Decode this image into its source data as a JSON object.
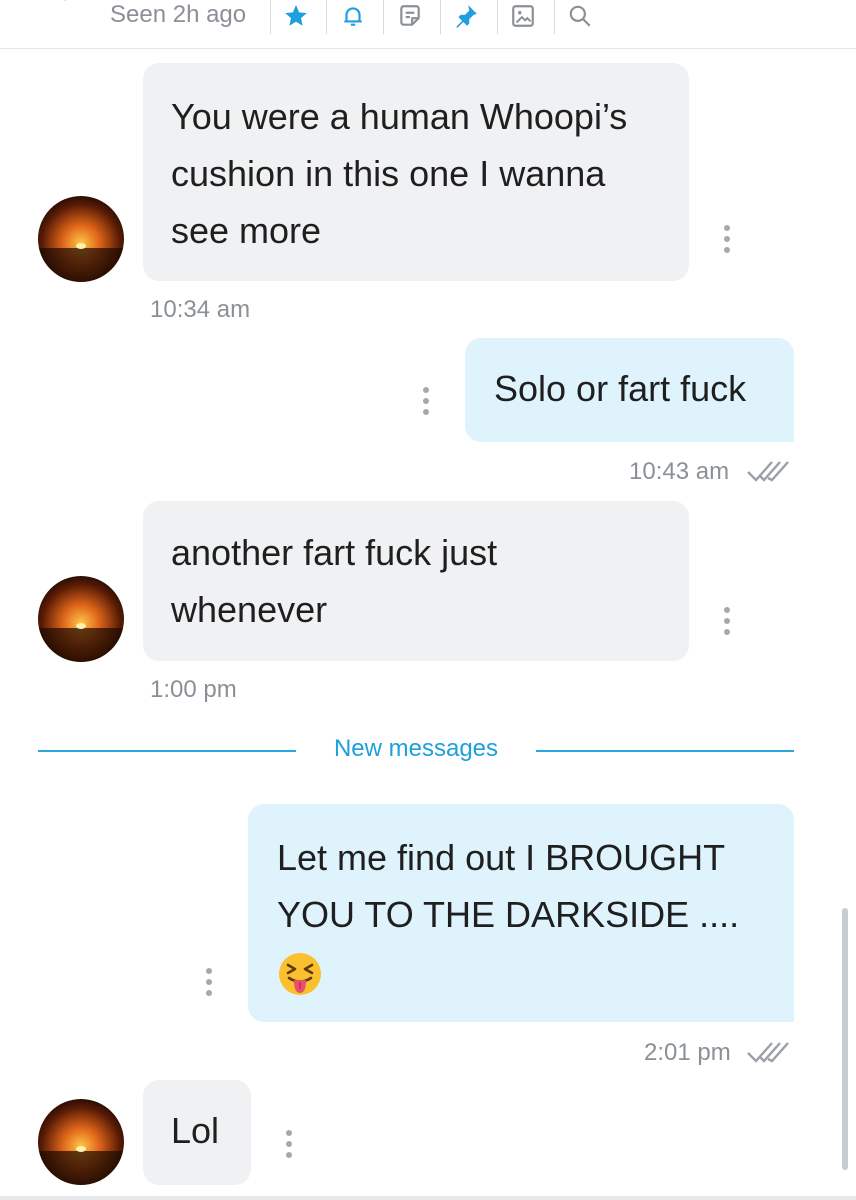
{
  "header": {
    "seen_text": "Seen 2h ago",
    "icons": [
      "star-icon",
      "bell-icon",
      "note-icon",
      "pin-icon",
      "image-icon",
      "search-icon"
    ]
  },
  "messages": [
    {
      "direction": "incoming",
      "text": "You were a human Whoopi’s\ncushion in this one I wanna\nsee more",
      "time": "10:34 am"
    },
    {
      "direction": "outgoing",
      "text": "Solo or fart fuck",
      "time": "10:43 am",
      "status": "read"
    },
    {
      "direction": "incoming",
      "text": "another fart fuck just\nwhenever",
      "time": "1:00 pm"
    },
    {
      "direction": "outgoing",
      "text": "Let me find out I BROUGHT\nYOU TO THE DARKSIDE ....",
      "emoji": "squinting-face-with-tongue",
      "time": "2:01 pm",
      "status": "read"
    },
    {
      "direction": "incoming",
      "text": "Lol"
    }
  ],
  "divider": {
    "label": "New messages"
  },
  "colors": {
    "accent": "#1ea0dc",
    "incoming_bubble": "#f0f1f3",
    "outgoing_bubble": "#dff3fd",
    "muted_text": "#8a9096"
  }
}
